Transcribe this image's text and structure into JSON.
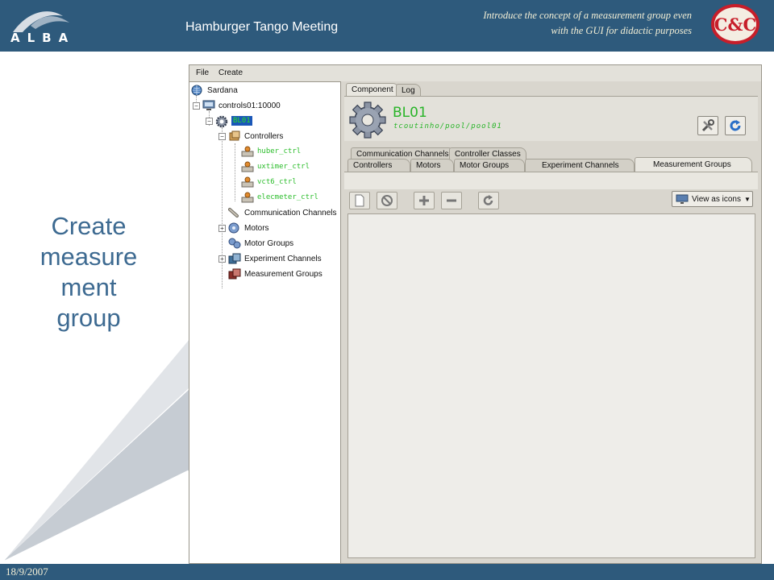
{
  "slide": {
    "header_title": "Hamburger Tango Meeting",
    "subtitle_line1": "Introduce the concept of  a measurement group even",
    "subtitle_line2": "with the GUI for didactic purposes",
    "logo_left_text": "ALBA",
    "logo_right_text": "C&C",
    "main_text_lines": [
      "Create",
      "measure",
      "ment",
      "group"
    ],
    "footer_date": "18/9/2007",
    "colors": {
      "bar": "#2e5a7c",
      "title": "#3d6a91",
      "green_text": "#28b428"
    }
  },
  "app": {
    "menu": [
      "File",
      "Create"
    ],
    "tree": {
      "root": "Sardana",
      "server": "controls01:10000",
      "pool": "BL01",
      "controllers_label": "Controllers",
      "controllers": [
        "huber_ctrl",
        "uxtimer_ctrl",
        "vct6_ctrl",
        "elecmeter_ctrl"
      ],
      "communication_channels": "Communication Channels",
      "motors": "Motors",
      "motor_groups": "Motor Groups",
      "experiment_channels": "Experiment Channels",
      "measurement_groups": "Measurement Groups"
    },
    "top_tabs": [
      "Component",
      "Log"
    ],
    "pool_title": "BL01",
    "pool_subtitle": "tcoutinho/pool/pool01",
    "tabs_row1": [
      "Communication Channels",
      "Controller Classes"
    ],
    "tabs_row2": [
      "Controllers",
      "Motors",
      "Motor Groups",
      "Experiment Channels",
      "Measurement Groups"
    ],
    "active_tab": "Measurement Groups",
    "view_label": "View as icons",
    "icons": [
      "new-icon",
      "stop-icon",
      "plus-icon",
      "minus-icon",
      "refresh-icon",
      "tools-icon",
      "reload-icon",
      "gear-icon",
      "monitor-icon"
    ]
  }
}
